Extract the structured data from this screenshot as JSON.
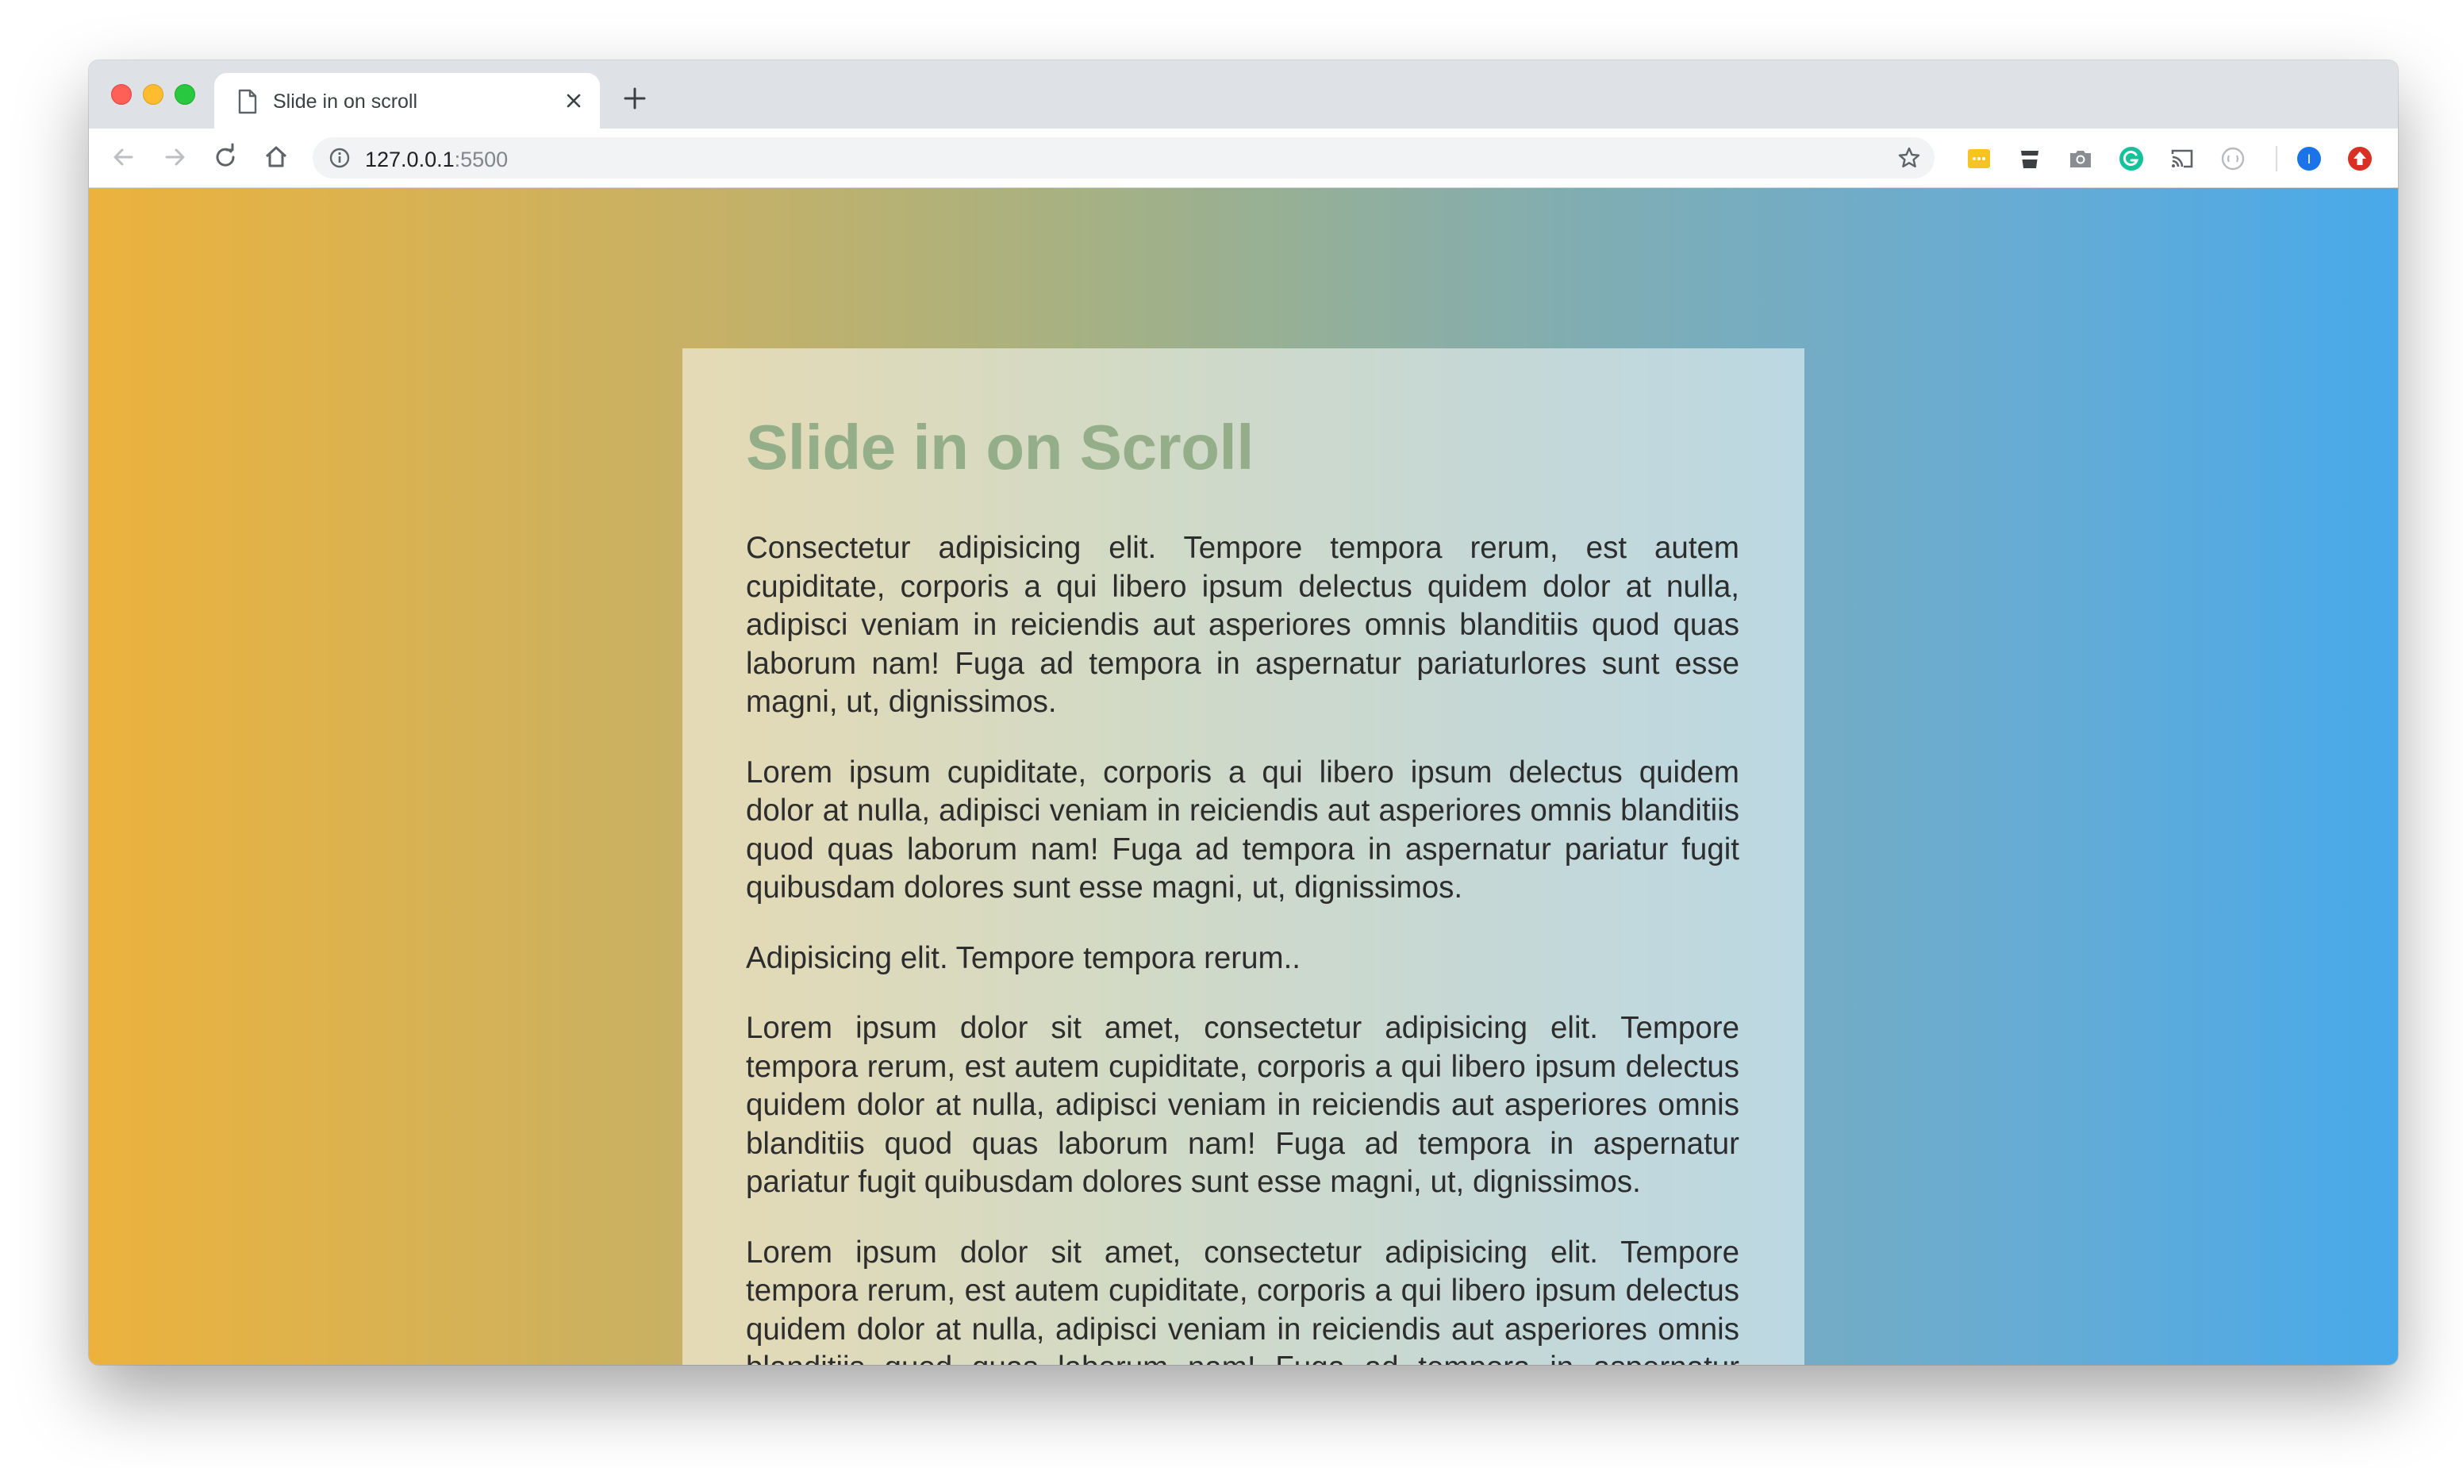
{
  "browser": {
    "tab_title": "Slide in on scroll",
    "url_host": "127.0.0.1",
    "url_port": ":5500",
    "profile_initial": "I"
  },
  "colors": {
    "gradient_start": "#ecb23d",
    "gradient_end": "#48a9ea",
    "heading": "#94ae8a",
    "card_background": "rgba(255,255,255,0.52)"
  },
  "icons": {
    "nav": [
      "back-arrow-icon",
      "forward-arrow-icon",
      "reload-icon",
      "home-icon"
    ],
    "omnibox": [
      "info-icon",
      "bookmark-star-icon"
    ],
    "extensions": [
      "yellow-extension-icon",
      "cup-extension-icon",
      "camera-icon",
      "grammarly-icon",
      "cast-icon",
      "globe-extension-icon",
      "profile-avatar-icon",
      "update-icon"
    ]
  },
  "page": {
    "heading": "Slide in on Scroll",
    "paragraphs": [
      "Consectetur adipisicing elit. Tempore tempora rerum, est autem cupiditate, corporis a qui libero ipsum delectus quidem dolor at nulla, adipisci veniam in reiciendis aut asperiores omnis blanditiis quod quas laborum nam! Fuga ad tempora in aspernatur pariaturlores sunt esse magni, ut, dignissimos.",
      "Lorem ipsum cupiditate, corporis a qui libero ipsum delectus quidem dolor at nulla, adipisci veniam in reiciendis aut asperiores omnis blanditiis quod quas laborum nam! Fuga ad tempora in aspernatur pariatur fugit quibusdam dolores sunt esse magni, ut, dignissimos.",
      "Adipisicing elit. Tempore tempora rerum..",
      "Lorem ipsum dolor sit amet, consectetur adipisicing elit. Tempore tempora rerum, est autem cupiditate, corporis a qui libero ipsum delectus quidem dolor at nulla, adipisci veniam in reiciendis aut asperiores omnis blanditiis quod quas laborum nam! Fuga ad tempora in aspernatur pariatur fugit quibusdam dolores sunt esse magni, ut, dignissimos.",
      "Lorem ipsum dolor sit amet, consectetur adipisicing elit. Tempore tempora rerum, est autem cupiditate, corporis a qui libero ipsum delectus quidem dolor at nulla, adipisci veniam in reiciendis aut asperiores omnis blanditiis quod quas laborum nam! Fuga ad tempora in aspernatur pariatur fugit quibusdam dolores sunt esse magni, ut, dignissimos."
    ]
  }
}
